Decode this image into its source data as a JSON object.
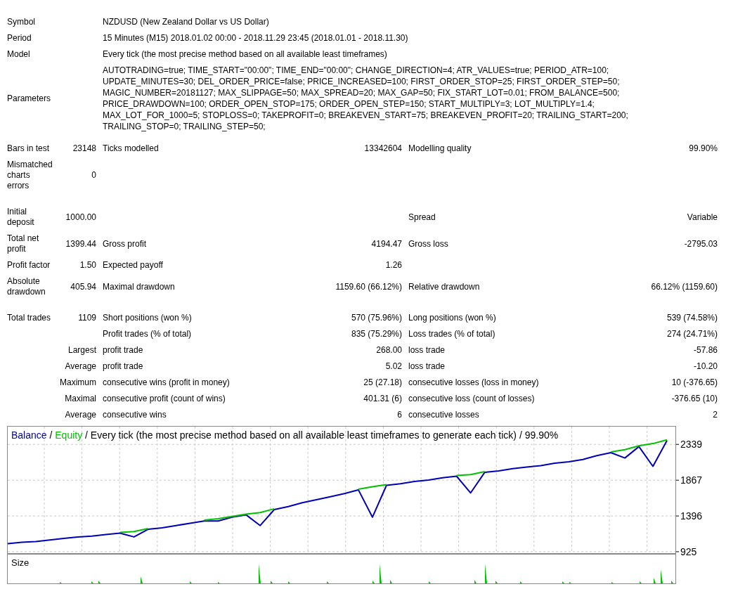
{
  "header": [
    {
      "label": "Symbol",
      "value": "NZDUSD (New Zealand Dollar vs US Dollar)"
    },
    {
      "label": "Period",
      "value": "15 Minutes (M15) 2018.01.02 00:00 - 2018.11.29 23:45 (2018.01.01 - 2018.11.30)"
    },
    {
      "label": "Model",
      "value": "Every tick (the most precise method based on all available least timeframes)"
    }
  ],
  "parameters": {
    "label": "Parameters",
    "lines": [
      "AUTOTRADING=true; TIME_START=\"00:00\"; TIME_END=\"00:00\"; CHANGE_DIRECTION=4; ATR_VALUES=true; PERIOD_ATR=100;",
      "UPDATE_MINUTES=30; DEL_ORDER_PRICE=false; PRICE_INCREASED=100; FIRST_ORDER_STOP=25; FIRST_ORDER_STEP=50;",
      "MAGIC_NUMBER=20181127; MAX_SLIPPAGE=50; MAX_SPREAD=20; MAX_GAP=50; FIX_START_LOT=0.01; FROM_BALANCE=500;",
      "PRICE_DRAWDOWN=100; ORDER_OPEN_STOP=175; ORDER_OPEN_STEP=150; START_MULTIPLY=3; LOT_MULTIPLY=1.4;",
      "MAX_LOT_FOR_1000=5; STOPLOSS=0; TAKEPROFIT=0; BREAKEVEN_START=75; BREAKEVEN_PROFIT=20; TRAILING_START=200;",
      "TRAILING_STOP=0; TRAILING_STEP=50;"
    ]
  },
  "sections": [
    [
      {
        "kind": "main",
        "label_1": "Bars in test",
        "value_1": "23148",
        "label_2": "Ticks modelled",
        "value_2": "13342604",
        "label_3": "Modelling quality",
        "value_3": "99.90%"
      },
      {
        "kind": "main",
        "label_1": "Mismatched charts errors",
        "value_1": "0"
      }
    ],
    [
      {
        "kind": "main",
        "label_1": "Initial deposit",
        "value_1": "1000.00",
        "label_3": "Spread",
        "value_3": "Variable"
      },
      {
        "kind": "main",
        "label_1": "Total net profit",
        "value_1": "1399.44",
        "label_2": "Gross profit",
        "value_2": "4194.47",
        "label_3": "Gross loss",
        "value_3": "-2795.03"
      },
      {
        "kind": "main",
        "label_1": "Profit factor",
        "value_1": "1.50",
        "label_2": "Expected payoff",
        "value_2": "1.26"
      },
      {
        "kind": "main",
        "label_1": "Absolute drawdown",
        "value_1": "405.94",
        "label_2": "Maximal drawdown",
        "value_2": "1159.60 (66.12%)",
        "label_3": "Relative drawdown",
        "value_3": "66.12% (1159.60)"
      }
    ],
    [
      {
        "kind": "main",
        "label_1": "Total trades",
        "value_1": "1109",
        "label_2": "Short positions (won %)",
        "value_2": "570 (75.96%)",
        "label_3": "Long positions (won %)",
        "value_3": "539 (74.58%)"
      },
      {
        "kind": "main",
        "label_2": "Profit trades (% of total)",
        "value_2": "835 (75.29%)",
        "label_3": "Loss trades (% of total)",
        "value_3": "274 (24.71%)"
      },
      {
        "kind": "sub",
        "label_1": "Largest",
        "label_2": "profit trade",
        "value_2": "268.00",
        "label_3": "loss trade",
        "value_3": "-57.86"
      },
      {
        "kind": "sub",
        "label_1": "Average",
        "label_2": "profit trade",
        "value_2": "5.02",
        "label_3": "loss trade",
        "value_3": "-10.20"
      },
      {
        "kind": "sub",
        "label_1": "Maximum",
        "label_2": "consecutive wins (profit in money)",
        "value_2": "25 (27.18)",
        "label_3": "consecutive losses (loss in money)",
        "value_3": "10 (-376.65)"
      },
      {
        "kind": "sub",
        "label_1": "Maximal",
        "label_2": "consecutive profit (count of wins)",
        "value_2": "401.31 (6)",
        "label_3": "consecutive loss (count of losses)",
        "value_3": "-376.65 (10)"
      },
      {
        "kind": "sub",
        "label_1": "Average",
        "label_2": "consecutive wins",
        "value_2": "6",
        "label_3": "consecutive losses",
        "value_3": "2"
      }
    ]
  ],
  "chart": {
    "legend_separator": "/",
    "chart_data": {
      "type": "line",
      "grid": true,
      "title": "Every tick (the most precise method based on all available least timeframes to generate each tick) / 99.90%",
      "ylim": [
        906,
        2582
      ],
      "yticks": [
        925,
        1396,
        1867,
        2339
      ],
      "series": [
        {
          "name": "Balance",
          "color": "#0000b4",
          "values": [
            1030,
            1050,
            1060,
            1080,
            1100,
            1120,
            1130,
            1150,
            1170,
            1120,
            1220,
            1240,
            1270,
            1300,
            1330,
            1330,
            1380,
            1410,
            1270,
            1480,
            1520,
            1570,
            1610,
            1650,
            1690,
            1740,
            1380,
            1800,
            1820,
            1850,
            1870,
            1900,
            1920,
            1700,
            1970,
            1990,
            2020,
            2040,
            2060,
            2090,
            2110,
            2140,
            2190,
            2230,
            2160,
            2310,
            2050,
            2390
          ]
        },
        {
          "name": "Equity",
          "color": "#00c000",
          "values": [
            null,
            null,
            null,
            null,
            null,
            null,
            null,
            null,
            1180,
            1190,
            1230,
            null,
            null,
            null,
            1340,
            1360,
            1390,
            1420,
            1440,
            1490,
            null,
            null,
            null,
            null,
            null,
            1750,
            1780,
            1810,
            null,
            null,
            null,
            null,
            1930,
            1940,
            1980,
            null,
            null,
            null,
            null,
            null,
            null,
            null,
            null,
            2240,
            2270,
            2320,
            2350,
            2400
          ]
        }
      ]
    },
    "volume_panel": {
      "label": "Size"
    }
  }
}
